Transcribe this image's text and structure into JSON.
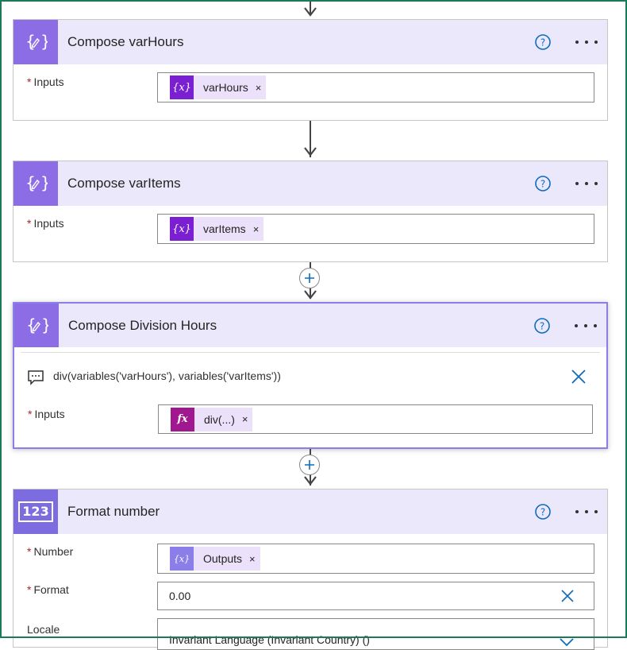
{
  "steps": {
    "compose_hours": {
      "title": "Compose varHours",
      "inputs_label": "Inputs",
      "token_label": "varHours",
      "token_icon_text": "{x}"
    },
    "compose_items": {
      "title": "Compose varItems",
      "inputs_label": "Inputs",
      "token_label": "varItems",
      "token_icon_text": "{x}"
    },
    "compose_division": {
      "title": "Compose Division Hours",
      "expression": "div(variables('varHours'), variables('varItems'))",
      "inputs_label": "Inputs",
      "token_label": "div(...)",
      "token_icon_text": "fx"
    },
    "format_number": {
      "title": "Format number",
      "icon_text": "123",
      "number_label": "Number",
      "number_token_label": "Outputs",
      "number_token_icon_text": "{𝑥}",
      "format_label": "Format",
      "format_value": "0.00",
      "locale_label": "Locale",
      "locale_value": "Invariant Language (Invariant Country) ()"
    }
  },
  "common": {
    "required_marker": "*",
    "token_remove": "×"
  },
  "colors": {
    "header_bg": "#ece8fb",
    "icon_bg": "#8c6de6",
    "variable_token": "#7a1fd2",
    "expression_token": "#a0178f",
    "accent_blue": "#0f6cbd",
    "required_red": "#a4262c"
  }
}
